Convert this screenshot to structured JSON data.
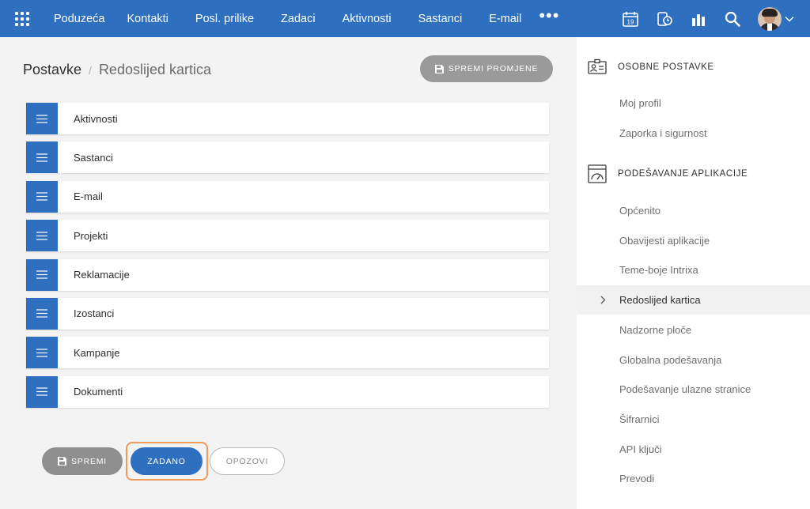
{
  "topbar": {
    "nav": [
      "Poduzeća",
      "Kontakti",
      "Posl. prilike",
      "Zadaci",
      "Aktivnosti",
      "Sastanci",
      "E-mail"
    ],
    "more": "•••",
    "calendar_day": "19",
    "colors": {
      "bar": "#2e6fbf"
    }
  },
  "breadcrumb": {
    "root": "Postavke",
    "separator": "/",
    "current": "Redoslijed kartica"
  },
  "buttons": {
    "save_changes": "SPREMI PROMJENE",
    "save": "SPREMI",
    "default": "ZADANO",
    "revert": "OPOZOVI"
  },
  "tabs": [
    "Aktivnosti",
    "Sastanci",
    "E-mail",
    "Projekti",
    "Reklamacije",
    "Izostanci",
    "Kampanje",
    "Dokumenti"
  ],
  "sidebar": {
    "personal": {
      "title": "OSOBNE POSTAVKE",
      "items": [
        "Moj profil",
        "Zaporka i sigurnost"
      ]
    },
    "app": {
      "title": "PODEŠAVANJE APLIKACIJE",
      "items": [
        "Općenito",
        "Obavijesti aplikacije",
        "Teme-boje Intrixa",
        "Redoslijed kartica",
        "Nadzorne ploče",
        "Globalna podešavanja",
        "Podešavanje ulazne stranice",
        "Šifrarnici",
        "API ključi",
        "Prevodi"
      ]
    },
    "active_item": "Redoslijed kartica"
  },
  "icons": {
    "apps": "apps-grid-icon",
    "calendar": "calendar-icon",
    "phone": "phone-icon",
    "reports": "bar-chart-icon",
    "search": "search-icon",
    "handle": "drag-handle-icon",
    "floppy": "floppy-disk-icon"
  }
}
